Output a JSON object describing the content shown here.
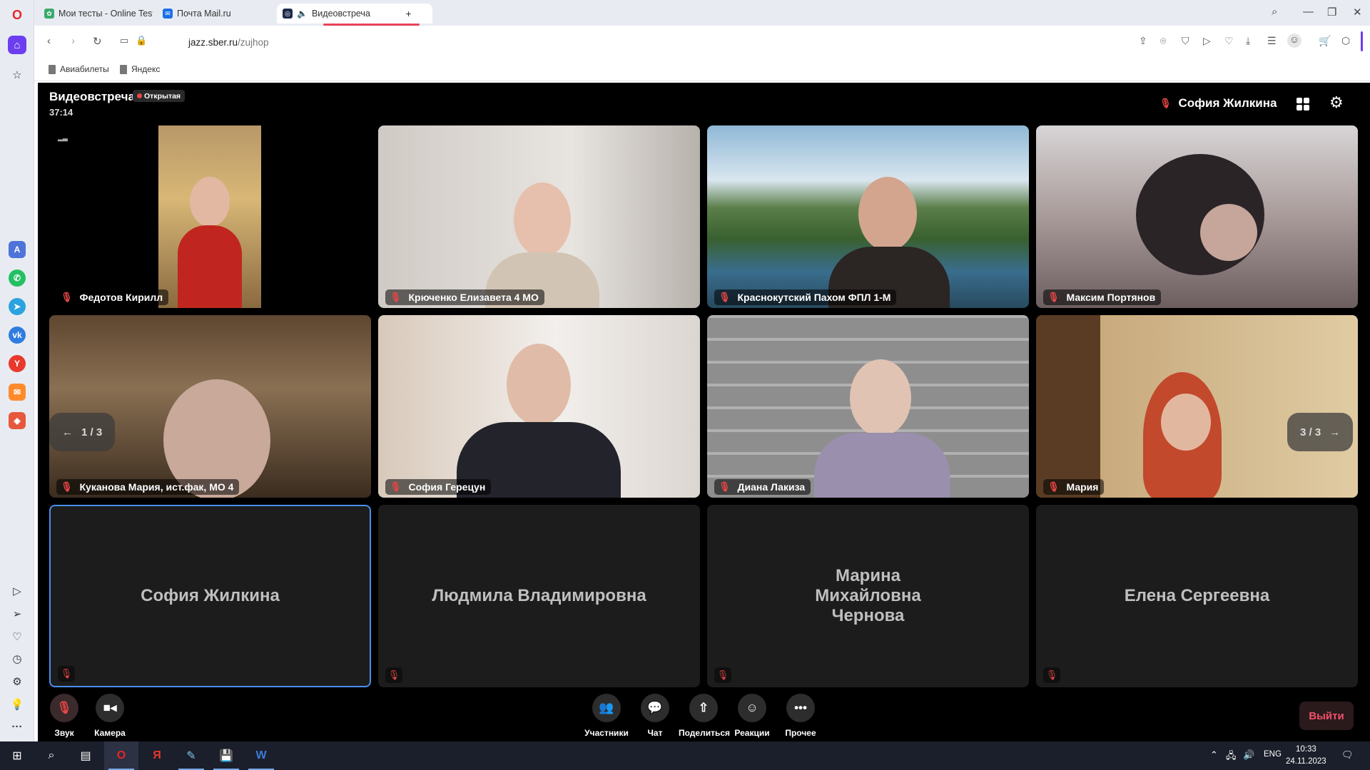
{
  "browser": {
    "tabs": [
      {
        "title": "Мои тесты - Online Test P",
        "icon": "leaf-icon"
      },
      {
        "title": "Почта Mail.ru",
        "icon": "mail-icon"
      },
      {
        "title": "Видеовстреча",
        "icon": "speaker-icon",
        "active": true
      }
    ],
    "new_tab_label": "+",
    "url_host": "jazz.sber.ru",
    "url_path": "/zujhop",
    "bookmarks": [
      "Авиабилеты",
      "Яндекс"
    ]
  },
  "meeting": {
    "title": "Видеовстреча",
    "badge": "Открытая",
    "timer": "37:14",
    "active_speaker": "София Жилкина",
    "pager_left": "1 / 3",
    "pager_right": "3 / 3"
  },
  "participants": [
    {
      "name": "Федотов Кирилл",
      "video": true,
      "bg": "#d9b778"
    },
    {
      "name": "Крюченко Елизавета 4 МО",
      "video": true,
      "bg": "#c9c4bd"
    },
    {
      "name": "Краснокутский Пахом ФПЛ 1-М",
      "video": true,
      "bg": "#8fb8d6"
    },
    {
      "name": "Максим Портянов",
      "video": true,
      "bg": "#a89a99"
    },
    {
      "name": "Куканова Мария, ист.фак, МО 4",
      "video": true,
      "bg": "#8a7053"
    },
    {
      "name": "София Герецун",
      "video": true,
      "bg": "#e7e2dd"
    },
    {
      "name": "Диана Лакиза",
      "video": true,
      "bg": "#9b9b9b"
    },
    {
      "name": "Мария",
      "video": true,
      "bg": "#c8aa7d"
    },
    {
      "name": "София Жилкина",
      "video": false,
      "selected": true
    },
    {
      "name": "Людмила Владимировна",
      "video": false
    },
    {
      "name": "Марина Михайловна Чернова",
      "video": false
    },
    {
      "name": "Елена Сергеевна",
      "video": false
    }
  ],
  "controls": {
    "sound": "Звук",
    "camera": "Камера",
    "participants": "Участники",
    "chat": "Чат",
    "share": "Поделиться",
    "reactions": "Реакции",
    "more": "Прочее",
    "leave": "Выйти"
  },
  "taskbar": {
    "lang": "ENG",
    "time": "10:33",
    "date": "24.11.2023"
  },
  "colors": {
    "accent_red": "#e64646",
    "leave_text": "#f0506a",
    "selected_border": "#4a8ff0"
  }
}
